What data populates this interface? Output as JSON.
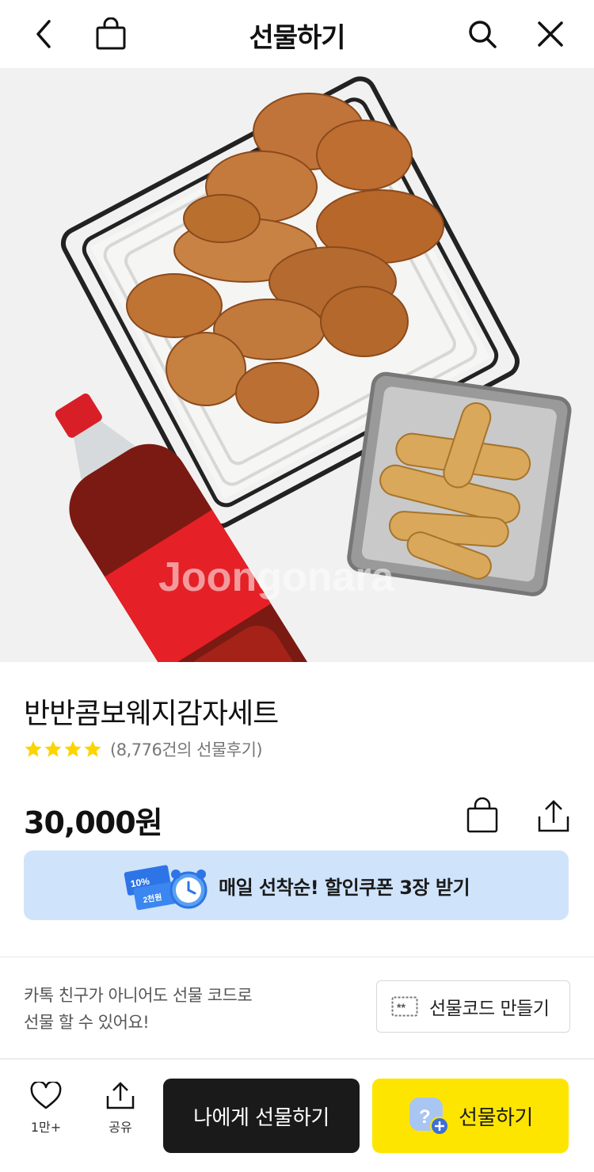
{
  "header": {
    "title": "선물하기"
  },
  "hero": {
    "watermark": "Joongonara"
  },
  "product": {
    "name": "반반콤보웨지감자세트",
    "rating_stars": 4,
    "review_count": "(8,776건의 선물후기)",
    "price": "30,000원"
  },
  "coupon": {
    "badge_top": "10%",
    "badge_bottom": "2천원",
    "text": "매일 선착순! 할인쿠폰 3장 받기"
  },
  "gift_code": {
    "description_line1": "카톡 친구가 아니어도 선물 코드로",
    "description_line2": "선물 할 수 있어요!",
    "button_icon_text": "**",
    "button_label": "선물코드 만들기"
  },
  "bottom_bar": {
    "like_count": "1만+",
    "share_label": "공유",
    "self_gift_label": "나에게 선물하기",
    "gift_label": "선물하기"
  },
  "colors": {
    "accent_yellow": "#fee500",
    "coupon_bg": "#cfe3fb",
    "star": "#fcd400",
    "dark_button": "#1a1a1a"
  }
}
